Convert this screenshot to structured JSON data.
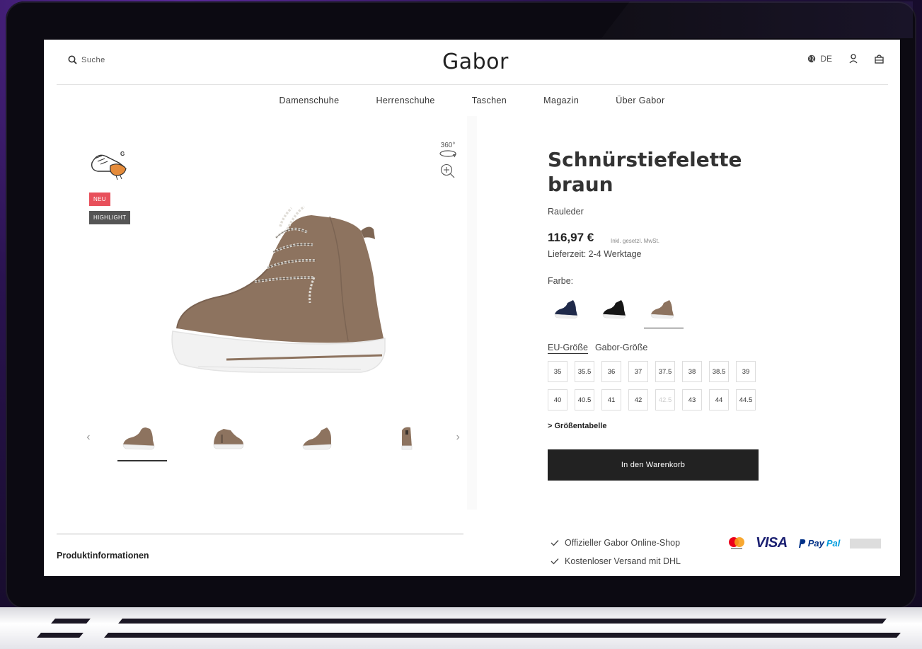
{
  "header": {
    "search_label": "Suche",
    "logo": "Gabor",
    "language": "DE"
  },
  "nav": [
    "Damenschuhe",
    "Herrenschuhe",
    "Taschen",
    "Magazin",
    "Über Gabor"
  ],
  "gallery": {
    "badges": {
      "new": "NEU",
      "highlight": "HIGHLIGHT"
    },
    "rotate_label": "360°",
    "prev_arrow": "‹",
    "next_arrow": "›"
  },
  "product": {
    "title": "Schnürstiefelette braun",
    "material": "Rauleder",
    "price": "116,97 €",
    "vat_note": "Inkl. gesetzl. MwSt.",
    "delivery": "Lieferzeit: 2-4 Werktage",
    "color_label": "Farbe:",
    "colors": [
      {
        "name": "navy",
        "hex": "#1f2a4a",
        "active": false
      },
      {
        "name": "black",
        "hex": "#161616",
        "active": false
      },
      {
        "name": "brown",
        "hex": "#8d735f",
        "active": true
      }
    ],
    "size_tabs": {
      "eu": "EU-Größe",
      "gabor": "Gabor-Größe"
    },
    "sizes": [
      {
        "label": "35",
        "available": true
      },
      {
        "label": "35.5",
        "available": true
      },
      {
        "label": "36",
        "available": true
      },
      {
        "label": "37",
        "available": true
      },
      {
        "label": "37.5",
        "available": true
      },
      {
        "label": "38",
        "available": true
      },
      {
        "label": "38.5",
        "available": true
      },
      {
        "label": "39",
        "available": true
      },
      {
        "label": "40",
        "available": true
      },
      {
        "label": "40.5",
        "available": true
      },
      {
        "label": "41",
        "available": true
      },
      {
        "label": "42",
        "available": true
      },
      {
        "label": "42.5",
        "available": false
      },
      {
        "label": "43",
        "available": true
      },
      {
        "label": "44",
        "available": true
      },
      {
        "label": "44.5",
        "available": true
      }
    ],
    "size_table_link": "> Größentabelle",
    "cart_button": "In den Warenkorb"
  },
  "footer": {
    "product_info": "Produktinformationen",
    "usps": [
      "Offizieller Gabor Online-Shop",
      "Kostenloser Versand mit DHL"
    ],
    "payments": {
      "visa": "VISA",
      "paypal_pay": "Pay",
      "paypal_pal": "Pal"
    }
  },
  "colors": {
    "badge_new": "#e8505b",
    "badge_highlight": "#555555",
    "button_bg": "#222222",
    "shoe_brown": "#8d735f"
  }
}
